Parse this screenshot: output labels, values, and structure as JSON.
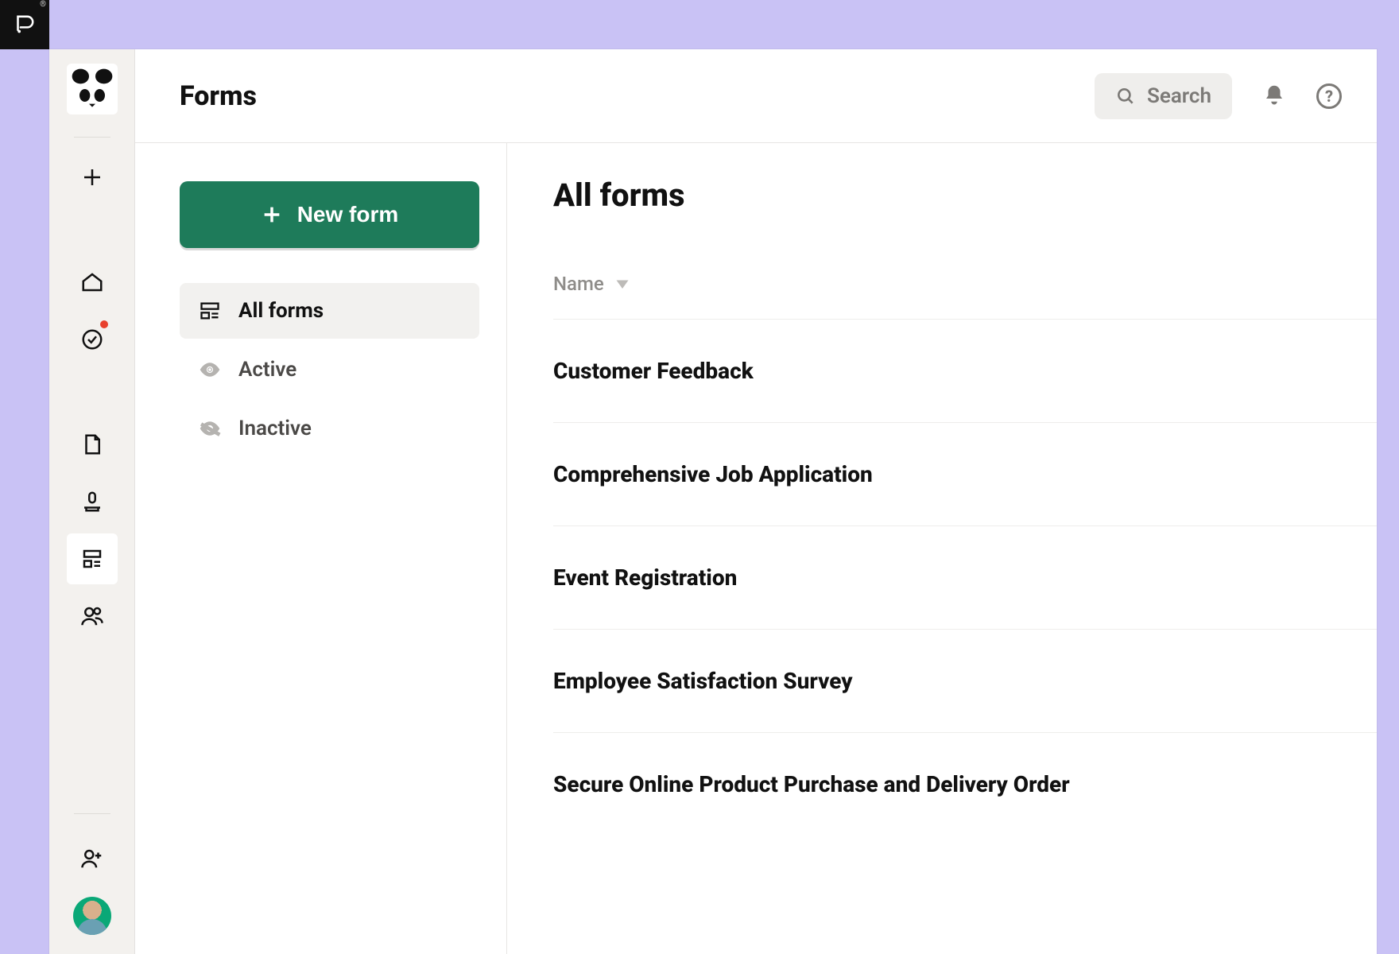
{
  "header": {
    "title": "Forms",
    "search_label": "Search"
  },
  "new_form_button": "New form",
  "filters": {
    "all": "All forms",
    "active": "Active",
    "inactive": "Inactive"
  },
  "list": {
    "heading": "All forms",
    "column": "Name",
    "rows": [
      "Customer Feedback",
      "Comprehensive Job Application",
      "Event Registration",
      "Employee Satisfaction Survey",
      "Secure Online Product Purchase and Delivery Order"
    ]
  }
}
